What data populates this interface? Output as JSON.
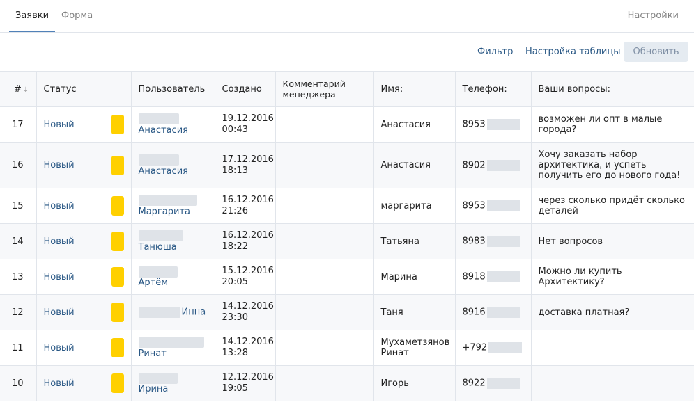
{
  "tabs": {
    "requests": "Заявки",
    "form": "Форма",
    "settings": "Настройки"
  },
  "toolbar": {
    "filter": "Фильтр",
    "columns": "Настройка таблицы",
    "refresh": "Обновить"
  },
  "columns": {
    "num": "#",
    "status": "Статус",
    "user": "Пользователь",
    "created": "Создано",
    "comment": "Комментарий менеджера",
    "name": "Имя:",
    "phone": "Телефон:",
    "questions": "Ваши вопросы:"
  },
  "status_color": "#ffd000",
  "rows": [
    {
      "num": "17",
      "status": "Новый",
      "user": "Анастасия",
      "date": "19.12.2016",
      "time": "00:43",
      "name": "Анастасия",
      "phone": "8953",
      "question": "возможен ли опт в малые города?"
    },
    {
      "num": "16",
      "status": "Новый",
      "user": "Анастасия",
      "date": "17.12.2016",
      "time": "18:13",
      "name": "Анастасия",
      "phone": "8902",
      "question": "Хочу заказать набор архитектика, и успеть получить его до нового года!"
    },
    {
      "num": "15",
      "status": "Новый",
      "user": "Маргарита",
      "date": "16.12.2016",
      "time": "21:26",
      "name": "маргарита",
      "phone": "8953",
      "question": "через сколько придёт сколько деталей"
    },
    {
      "num": "14",
      "status": "Новый",
      "user": "Танюша",
      "date": "16.12.2016",
      "time": "18:22",
      "name": "Татьяна",
      "phone": "8983",
      "question": "Нет вопросов"
    },
    {
      "num": "13",
      "status": "Новый",
      "user": "Артём",
      "date": "15.12.2016",
      "time": "20:05",
      "name": "Марина",
      "phone": "8918",
      "question": "Можно ли купить Архитектику?"
    },
    {
      "num": "12",
      "status": "Новый",
      "user": "Инна",
      "date": "14.12.2016",
      "time": "23:30",
      "name": "Таня",
      "phone": "8916",
      "question": "доставка платная?"
    },
    {
      "num": "11",
      "status": "Новый",
      "user": "Ринат",
      "date": "14.12.2016",
      "time": "13:28",
      "name": "Мухаметзянов Ринат",
      "phone": "+792",
      "question": ""
    },
    {
      "num": "10",
      "status": "Новый",
      "user": "Ирина",
      "date": "12.12.2016",
      "time": "19:05",
      "name": "Игорь",
      "phone": "8922",
      "question": ""
    }
  ]
}
